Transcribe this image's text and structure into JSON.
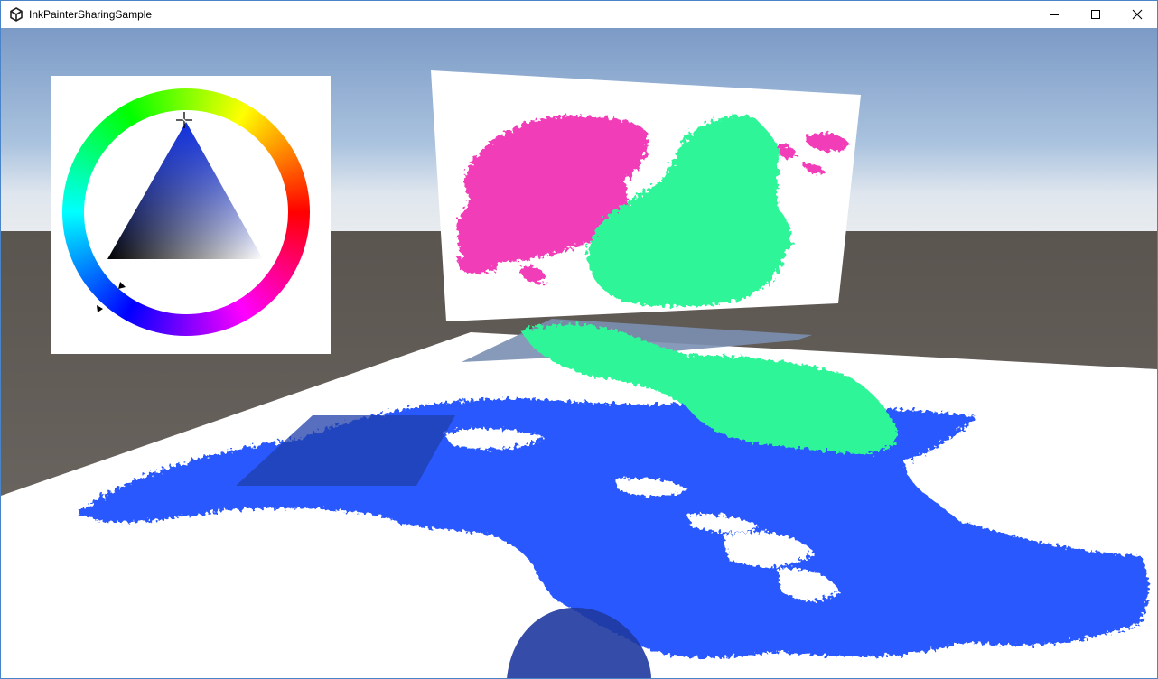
{
  "window": {
    "title": "InkPainterSharingSample",
    "controls": [
      "minimize",
      "maximize",
      "close"
    ]
  },
  "scene": {
    "sky_color": "#8aaed4",
    "ground_color": "#6e6763",
    "floor_color": "#ffffff",
    "ink_colors": {
      "blue": "#2a58ff",
      "green": "#2ff598",
      "pink": "#f23cb8"
    }
  },
  "color_picker": {
    "selected_color": "#0000ff",
    "icons": [
      "hue-wheel",
      "saturation-value-triangle",
      "crosshair-cursor"
    ]
  }
}
